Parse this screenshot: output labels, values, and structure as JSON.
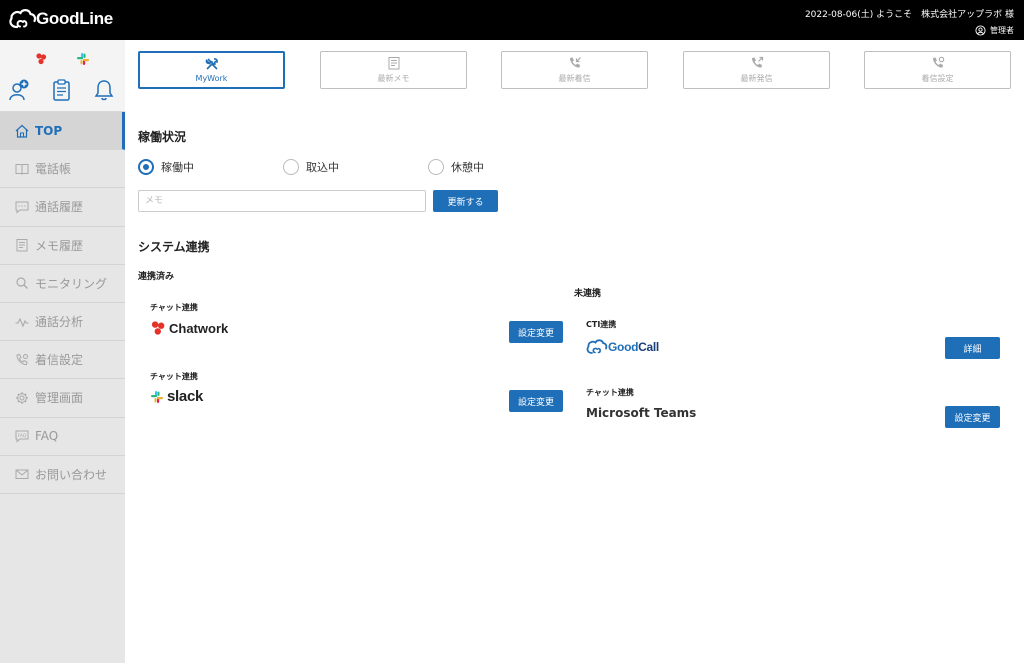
{
  "header": {
    "logo_text_1": "Good",
    "logo_text_2": "Line",
    "welcome": "2022-08-06(土) ようこそ　株式会社アップラボ 様",
    "role": "管理者"
  },
  "sidebar": {
    "items": [
      {
        "label": "TOP",
        "icon": "home-icon"
      },
      {
        "label": "電話帳",
        "icon": "book-icon"
      },
      {
        "label": "通話履歴",
        "icon": "chat-icon"
      },
      {
        "label": "メモ履歴",
        "icon": "memo-icon"
      },
      {
        "label": "モニタリング",
        "icon": "search-icon"
      },
      {
        "label": "通話分析",
        "icon": "analytics-icon"
      },
      {
        "label": "着信設定",
        "icon": "phone-settings-icon"
      },
      {
        "label": "管理画面",
        "icon": "gear-icon"
      },
      {
        "label": "FAQ",
        "icon": "faq-icon"
      },
      {
        "label": "お問い合わせ",
        "icon": "mail-icon"
      }
    ]
  },
  "tabs": [
    {
      "label": "MyWork",
      "icon": "tools-icon"
    },
    {
      "label": "最新メモ",
      "icon": "memo-icon"
    },
    {
      "label": "最新着信",
      "icon": "incoming-call-icon"
    },
    {
      "label": "最新発信",
      "icon": "outgoing-call-icon"
    },
    {
      "label": "着信設定",
      "icon": "phone-settings-icon"
    }
  ],
  "status": {
    "title": "稼働状況",
    "options": [
      "稼働中",
      "取込中",
      "休憩中"
    ],
    "selected": "稼働中",
    "memo_placeholder": "メモ",
    "update_label": "更新する"
  },
  "integration": {
    "title": "システム連携",
    "linked_title": "連携済み",
    "unlinked_title": "未連携",
    "linked": [
      {
        "category": "チャット連携",
        "name": "Chatwork",
        "button": "設定変更"
      },
      {
        "category": "チャット連携",
        "name": "slack",
        "button": "設定変更"
      }
    ],
    "unlinked": [
      {
        "category": "CTI連携",
        "name_1": "Good",
        "name_2": "Call",
        "button": "詳細"
      },
      {
        "category": "チャット連携",
        "name": "Microsoft Teams",
        "button": "設定変更"
      }
    ]
  },
  "colors": {
    "accent": "#1f6fb8",
    "header_bg": "#000000",
    "sidebar_bg": "#e6e6e6"
  }
}
